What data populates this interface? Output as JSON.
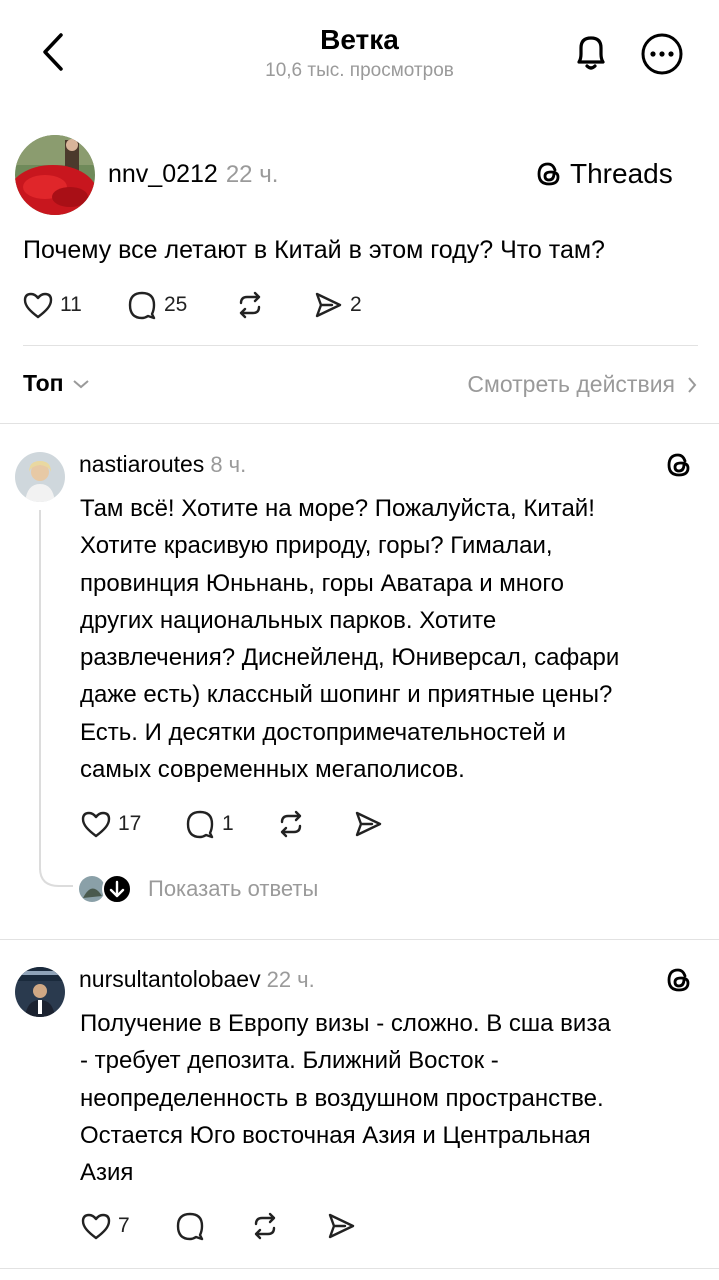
{
  "header": {
    "title": "Ветка",
    "subtitle": "10,6 тыс. просмотров"
  },
  "main_post": {
    "username": "nnv_0212",
    "time": "22 ч.",
    "brand": "Threads",
    "text": "Почему все летают в Китай в этом году? Что там?",
    "likes": "11",
    "comments": "25",
    "shares": "2"
  },
  "sort": {
    "label": "Топ",
    "view_activity": "Смотреть действия"
  },
  "replies": [
    {
      "username": "nastiaroutes",
      "time": "8 ч.",
      "lines": [
        "Там всё! Хотите на море? Пожалуйста, Китай!",
        "Хотите красивую природу, горы? Гималаи,",
        "провинция Юньнань, горы Аватара и много",
        "других национальных парков. Хотите",
        "развлечения? Диснейленд, Юниверсал, сафари",
        "даже есть) классный шопинг и приятные цены?",
        "Есть. И десятки достопримечательностей и",
        "самых современных мегаполисов."
      ],
      "likes": "17",
      "comments": "1",
      "show_replies": "Показать ответы"
    },
    {
      "username": "nursultantolobaev",
      "time": "22 ч.",
      "lines": [
        "Получение в Европу визы - сложно. В сша виза",
        "- требует депозита. Ближний Восток -",
        "неопределенность в воздушном пространстве.",
        "Остается Юго восточная Азия и Центральная",
        "Азия"
      ],
      "likes": "7"
    }
  ],
  "colors": {
    "text": "#000000",
    "muted": "#9a9a9a",
    "divider": "#e2e2e2",
    "avatar_red": "#c8161e"
  },
  "icons": [
    "back-icon",
    "bell-icon",
    "more-icon",
    "threads-icon",
    "heart-icon",
    "comment-icon",
    "repost-icon",
    "share-icon",
    "chevron-down-icon",
    "chevron-right-icon",
    "arrow-down-icon"
  ]
}
